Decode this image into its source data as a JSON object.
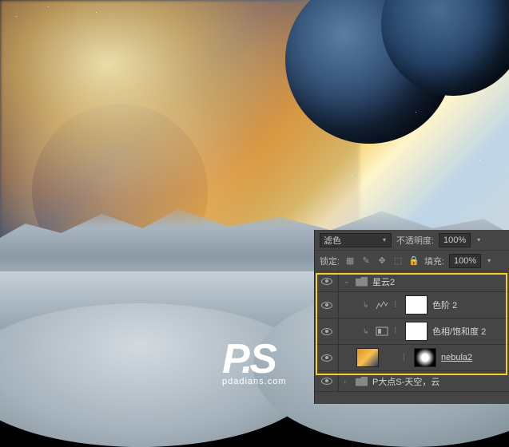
{
  "panel": {
    "blend_mode": "滤色",
    "opacity_label": "不透明度:",
    "opacity_value": "100%",
    "lock_label": "锁定:",
    "fill_label": "填充:",
    "fill_value": "100%"
  },
  "layers": {
    "group": "星云2",
    "levels": "色阶 2",
    "levels_suffix": "",
    "huesat": "色相/饱和度 2",
    "huesat_suffix": "",
    "nebula": "nebula2",
    "bottom_group": "P大点S-天空，云"
  },
  "watermark": {
    "main": "P.S",
    "sub": "pdadians.com"
  }
}
